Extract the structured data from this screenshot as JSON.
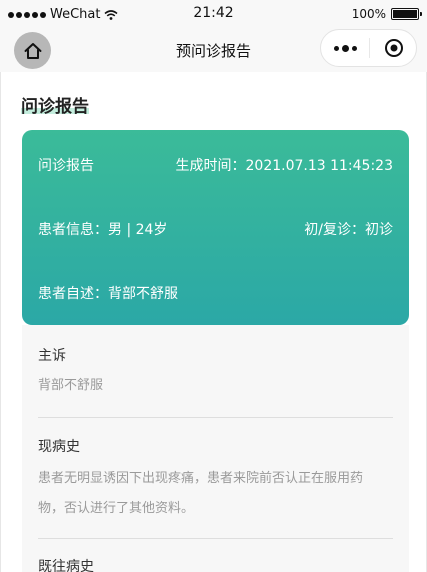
{
  "status_bar": {
    "carrier": "WeChat",
    "time": "21:42",
    "battery": "100%"
  },
  "nav": {
    "title": "预问诊报告"
  },
  "section": {
    "title": "问诊报告"
  },
  "card": {
    "heading": "问诊报告",
    "generated_time": "生成时间：2021.07.13 11:45:23",
    "patient_info": "患者信息：男 | 24岁",
    "visit_type": "初/复诊：初诊",
    "self_report": "患者自述：背部不舒服"
  },
  "details": {
    "chief_complaint_label": "主诉",
    "chief_complaint_value": "背部不舒服",
    "present_illness_label": "现病史",
    "present_illness_value_line1": "患者无明显诱因下出现疼痛，患者来院前否认正在服用药",
    "present_illness_value_line2": "物，否认进行了其他资料。",
    "past_history_label": "既往病史"
  }
}
